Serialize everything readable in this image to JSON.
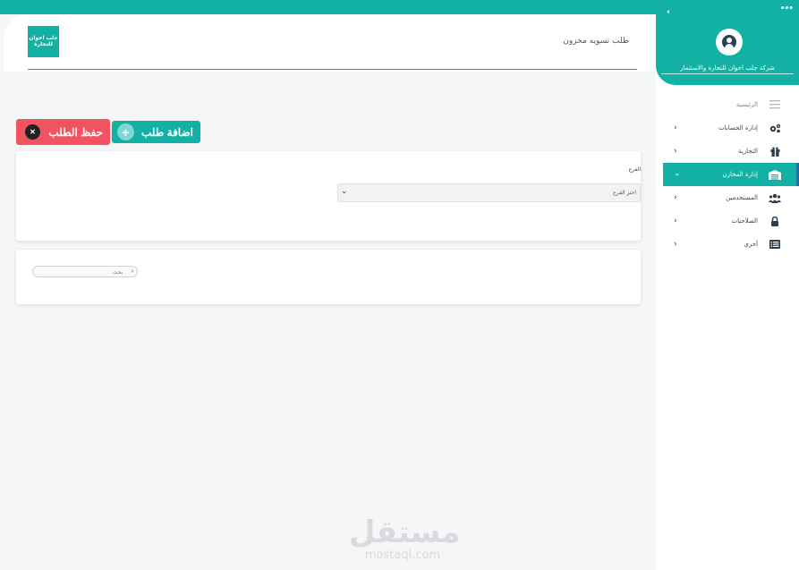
{
  "company_name": "شركة جلب اخوان للتجارة والاستثمار",
  "logo_text": "جلب اخوان للتجارة",
  "page_title": "طلب تسويه مخزون",
  "sidebar": {
    "dots": "•••",
    "collapse_icon": "chevron-left-icon",
    "items": [
      {
        "label": "الرئيسية",
        "icon": "hamburger-icon",
        "chevron": ""
      },
      {
        "label": "إدارة الحسابات",
        "icon": "gears-icon",
        "chevron": "‹"
      },
      {
        "label": "التجارية",
        "icon": "gift-icon",
        "chevron": "‹"
      },
      {
        "label": "إدارة المخازن",
        "icon": "warehouse-icon",
        "chevron": "⌄"
      },
      {
        "label": "المستخدمين",
        "icon": "users-icon",
        "chevron": "‹"
      },
      {
        "label": "الصلاحيات",
        "icon": "lock-icon",
        "chevron": "‹"
      },
      {
        "label": "أخرى",
        "icon": "list-icon",
        "chevron": "‹"
      }
    ],
    "active_index": 3
  },
  "toolbar": {
    "save_label": "حفظ الطلب",
    "add_label": "اضافة طلب"
  },
  "form": {
    "branch_label": "الفرع",
    "branch_placeholder": "اختر الفرع"
  },
  "search": {
    "placeholder": "بحث"
  },
  "watermark": {
    "arabic": "مستقل",
    "latin": "mostaql.com"
  },
  "colors": {
    "accent": "#13b1a5",
    "danger": "#f25361",
    "active_border": "#2c6bb0"
  }
}
